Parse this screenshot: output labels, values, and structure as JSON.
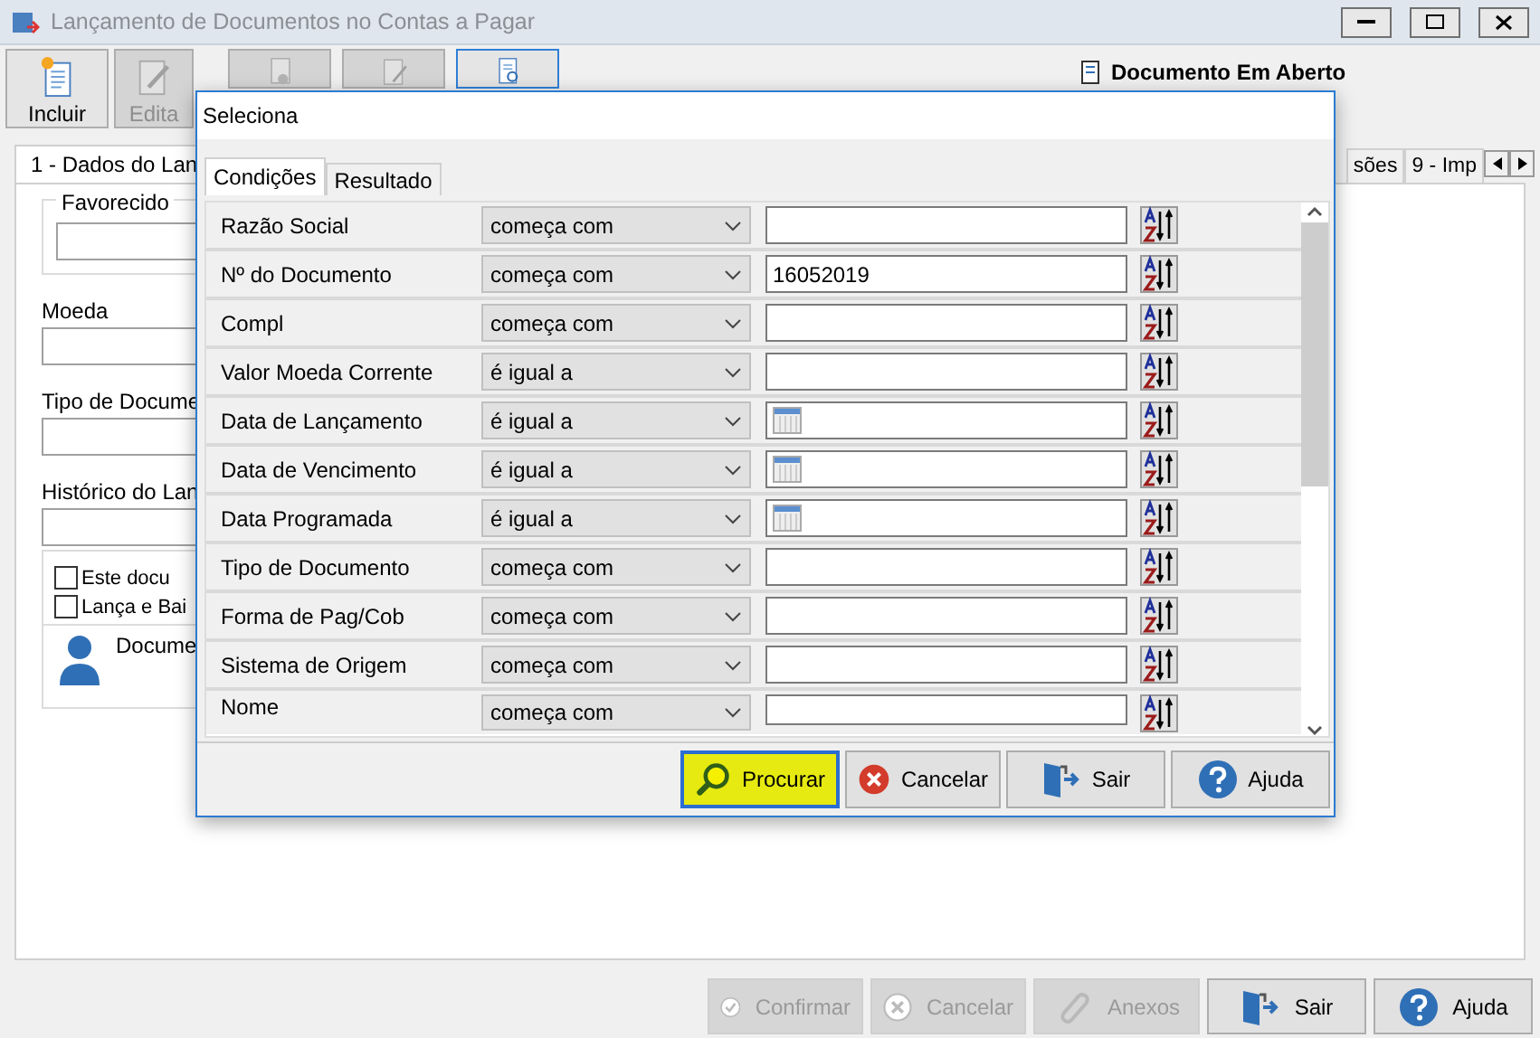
{
  "window": {
    "title": "Lançamento de Documentos no Contas a Pagar"
  },
  "toolbar": [
    {
      "kind": "new",
      "label": "Incluir",
      "disabled": false,
      "selected": false
    },
    {
      "kind": "edit",
      "label": "Edita",
      "disabled": true,
      "selected": false
    },
    {
      "kind": "delete",
      "disabled": true,
      "selected": false
    },
    {
      "kind": "copy",
      "disabled": true,
      "selected": false
    },
    {
      "kind": "find",
      "disabled": false,
      "selected": true
    }
  ],
  "status_text": "Documento Em Aberto",
  "main_tabs": [
    {
      "label": "1 - Dados do Lan",
      "selected": true
    },
    {
      "label": "sões",
      "selected": false
    },
    {
      "label": "9 - Imp",
      "selected": false
    }
  ],
  "form": {
    "group_label": "Favorecido",
    "fields": [
      "Moeda",
      "Tipo de Docume",
      "Histórico do Lan"
    ],
    "checkboxes": [
      {
        "label": "Este docu",
        "checked": false
      },
      {
        "label": "Lança e Bai",
        "checked": false
      }
    ],
    "info_text": "Docume"
  },
  "dialog": {
    "title": "Seleciona",
    "tabs": [
      {
        "label": "Condições",
        "selected": true
      },
      {
        "label": "Resultado",
        "selected": false
      }
    ],
    "rows": [
      {
        "label": "Razão Social",
        "operator": "começa com",
        "kind": "text"
      },
      {
        "label": "Nº do Documento",
        "operator": "começa com",
        "kind": "text",
        "value": "16052019"
      },
      {
        "label": "Compl",
        "operator": "começa com",
        "kind": "text"
      },
      {
        "label": "Valor Moeda Corrente",
        "operator": "é igual a",
        "kind": "text"
      },
      {
        "label": "Data de Lançamento",
        "operator": "é igual a",
        "kind": "date"
      },
      {
        "label": "Data de Vencimento",
        "operator": "é igual a",
        "kind": "date"
      },
      {
        "label": "Data Programada",
        "operator": "é igual a",
        "kind": "date"
      },
      {
        "label": "Tipo de Documento",
        "operator": "começa com",
        "kind": "text"
      },
      {
        "label": "Forma de Pag/Cob",
        "operator": "começa com",
        "kind": "text"
      },
      {
        "label": "Sistema de Origem",
        "operator": "começa com",
        "kind": "text"
      },
      {
        "label": "Nome",
        "operator": "começa com",
        "kind": "text"
      }
    ],
    "buttons": [
      {
        "label": "Procurar",
        "kind": "search",
        "highlighted": true
      },
      {
        "label": "Cancelar",
        "kind": "cancel",
        "highlighted": false
      },
      {
        "label": "Sair",
        "kind": "exit",
        "highlighted": false
      },
      {
        "label": "Ajuda",
        "kind": "help",
        "highlighted": false
      }
    ]
  },
  "footer_buttons": [
    {
      "label": "Confirmar",
      "kind": "confirm",
      "disabled": true
    },
    {
      "label": "Cancelar",
      "kind": "cancel",
      "disabled": true
    },
    {
      "label": "Anexos",
      "kind": "attach",
      "disabled": true
    },
    {
      "label": "Sair",
      "kind": "exit",
      "disabled": false
    },
    {
      "label": "Ajuda",
      "kind": "help",
      "disabled": false
    }
  ]
}
